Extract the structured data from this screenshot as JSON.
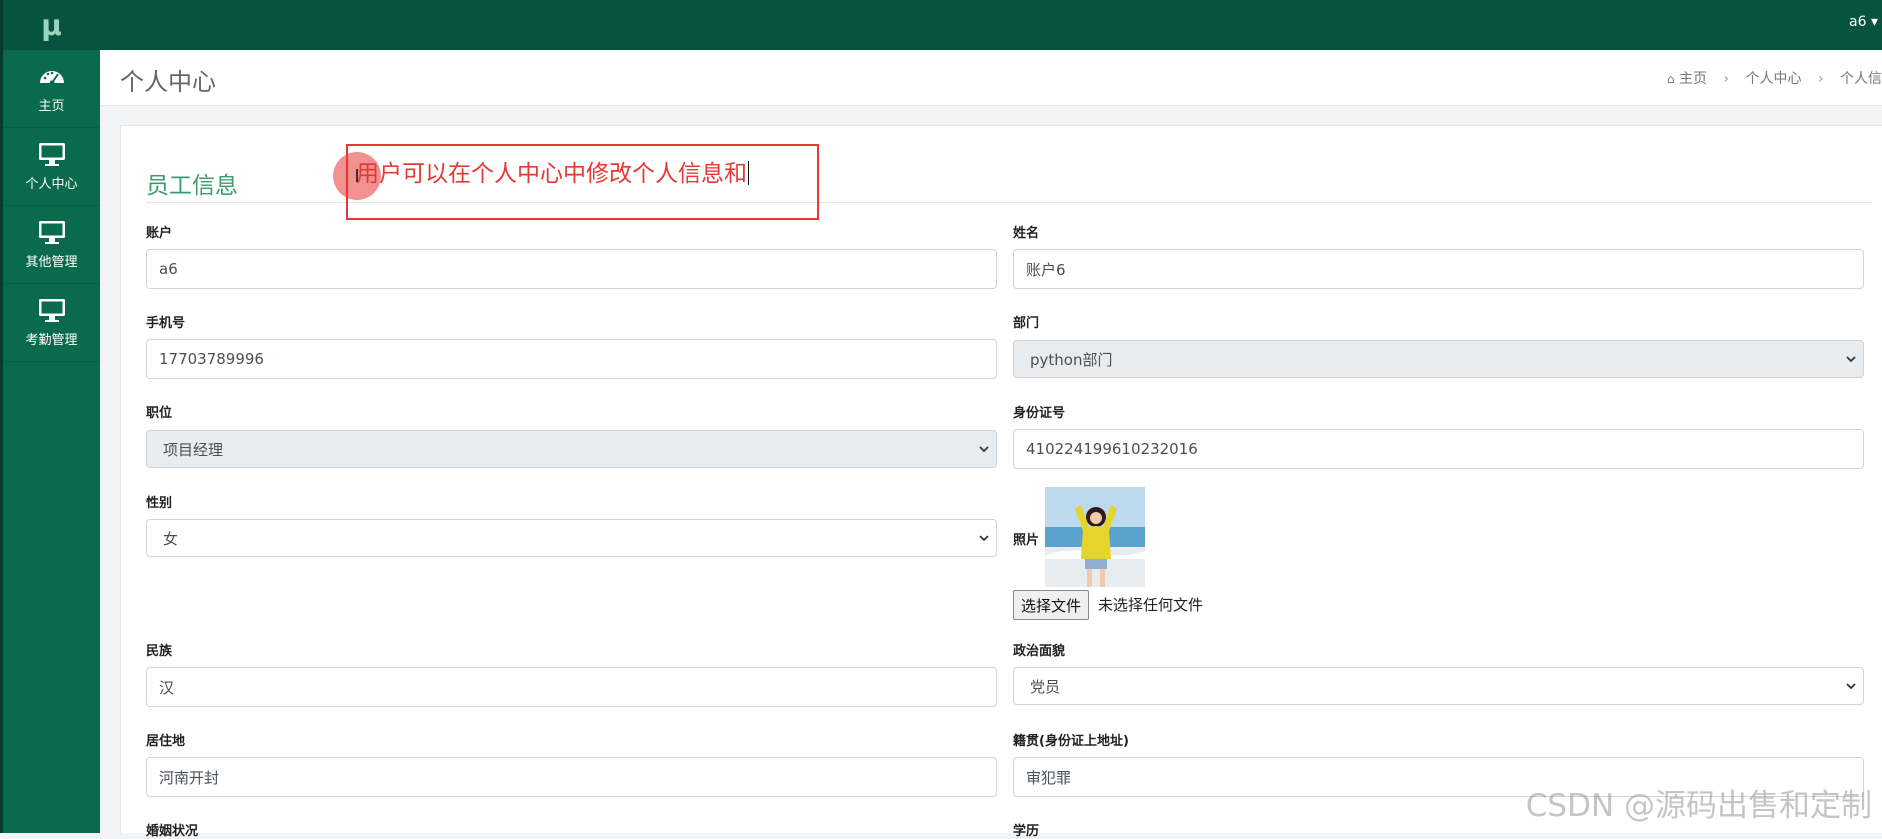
{
  "app": {
    "logo": "μ"
  },
  "topbar": {
    "user": "a6 ▾"
  },
  "sidebar": {
    "items": [
      {
        "label": "主页",
        "icon": "dashboard-icon"
      },
      {
        "label": "个人中心",
        "icon": "monitor-icon"
      },
      {
        "label": "其他管理",
        "icon": "monitor-icon"
      },
      {
        "label": "考勤管理",
        "icon": "monitor-icon"
      }
    ]
  },
  "header": {
    "title": "个人中心",
    "breadcrumb": [
      "主页",
      "个人中心",
      "个人信"
    ]
  },
  "card": {
    "title": "员工信息"
  },
  "annotation": {
    "text": "用户可以在个人中心中修改个人信息和",
    "color": "#e53935"
  },
  "form": {
    "account": {
      "label": "账户",
      "value": "a6"
    },
    "name": {
      "label": "姓名",
      "value": "账户6"
    },
    "phone": {
      "label": "手机号",
      "value": "17703789996"
    },
    "department": {
      "label": "部门",
      "value": "python部门"
    },
    "position": {
      "label": "职位",
      "value": "项目经理"
    },
    "id_number": {
      "label": "身份证号",
      "value": "410224199610232016"
    },
    "gender": {
      "label": "性别",
      "value": "女"
    },
    "photo": {
      "label": "照片",
      "button": "选择文件",
      "status": "未选择任何文件"
    },
    "ethnicity": {
      "label": "民族",
      "value": "汉"
    },
    "political": {
      "label": "政治面貌",
      "value": "党员"
    },
    "residence": {
      "label": "居住地",
      "value": "河南开封"
    },
    "native_place": {
      "label": "籍贯(身份证上地址)",
      "value": "审犯罪"
    },
    "marital": {
      "label": "婚姻状况"
    },
    "education": {
      "label": "学历"
    }
  },
  "watermark": "CSDN @源码出售和定制",
  "colors": {
    "sidebar": "#0a6b4c",
    "topbar": "#065440",
    "accent": "#3c9b73"
  }
}
